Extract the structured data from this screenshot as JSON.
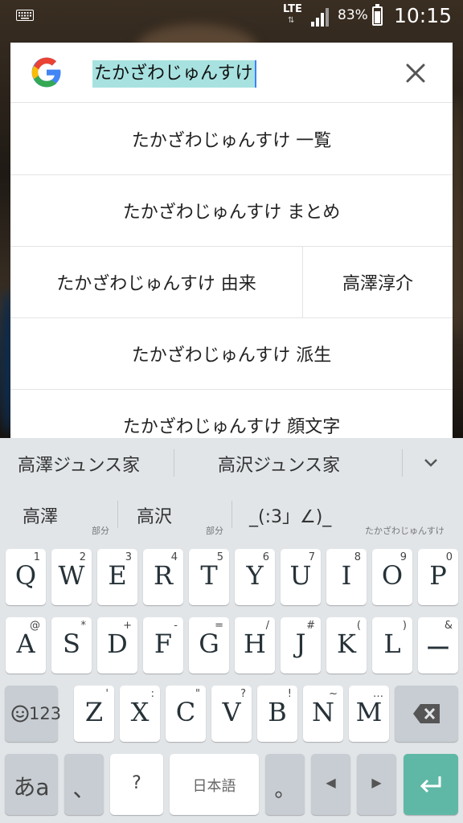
{
  "status_bar": {
    "network": "LTE",
    "battery_percent": "83%",
    "time": "10:15"
  },
  "search": {
    "query": "たかざわじゅんすけ",
    "suggestions": [
      "たかざわじゅんすけ 一覧",
      "たかざわじゅんすけ まとめ",
      "たかざわじゅんすけ 由来",
      "高澤淳介",
      "たかざわじゅんすけ 派生",
      "たかざわじゅんすけ 顔文字"
    ]
  },
  "keyboard": {
    "candidates_row1": [
      "高澤ジュンス家",
      "高沢ジュンス家"
    ],
    "candidates_row2": [
      "高澤",
      "部分",
      "高沢",
      "部分",
      "_(:3」∠)_",
      "たかざわじゅんすけ"
    ],
    "row1": [
      {
        "main": "Q",
        "sub": "1"
      },
      {
        "main": "W",
        "sub": "2"
      },
      {
        "main": "E",
        "sub": "3"
      },
      {
        "main": "R",
        "sub": "4"
      },
      {
        "main": "T",
        "sub": "5"
      },
      {
        "main": "Y",
        "sub": "6"
      },
      {
        "main": "U",
        "sub": "7"
      },
      {
        "main": "I",
        "sub": "8"
      },
      {
        "main": "O",
        "sub": "9"
      },
      {
        "main": "P",
        "sub": "0"
      }
    ],
    "row2": [
      {
        "main": "A",
        "sub": "@"
      },
      {
        "main": "S",
        "sub": "*"
      },
      {
        "main": "D",
        "sub": "+"
      },
      {
        "main": "F",
        "sub": "-"
      },
      {
        "main": "G",
        "sub": "="
      },
      {
        "main": "H",
        "sub": "/"
      },
      {
        "main": "J",
        "sub": "#"
      },
      {
        "main": "K",
        "sub": "("
      },
      {
        "main": "L",
        "sub": ")"
      },
      {
        "main": "ー",
        "sub": "&"
      }
    ],
    "row3": [
      {
        "main": "Z",
        "sub": "'"
      },
      {
        "main": "X",
        "sub": ":"
      },
      {
        "main": "C",
        "sub": "\""
      },
      {
        "main": "V",
        "sub": "?"
      },
      {
        "main": "B",
        "sub": "!"
      },
      {
        "main": "N",
        "sub": "~"
      },
      {
        "main": "M",
        "sub": "…"
      }
    ],
    "num_key": "123",
    "lang_key": "あa",
    "comma_key": "、",
    "question_key": "?",
    "space_key": "日本語",
    "period_key": "。",
    "left_key": "◀",
    "right_key": "▶"
  },
  "colors": {
    "highlight": "#a8e2e0",
    "enter_key": "#5fb8a6",
    "keyboard_bg": "#e1e5e8"
  }
}
